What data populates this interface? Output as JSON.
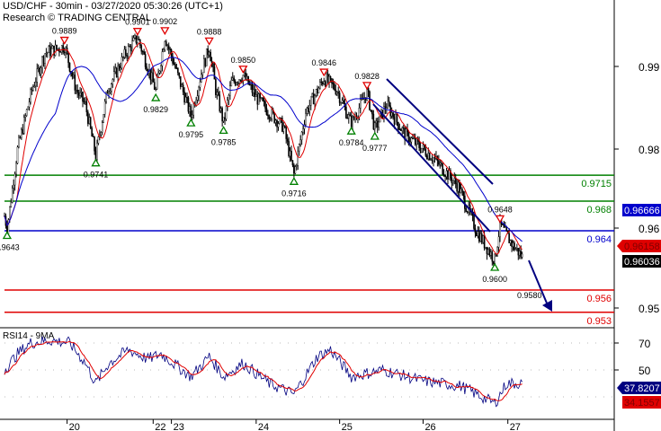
{
  "header": {
    "title": "USD/CHF - 30min - 03/27/2020 05:30:26 (UTC+1)",
    "source": "Research © TRADING CENTRAL"
  },
  "colors": {
    "up_marker": "#008000",
    "down_marker": "#e00000",
    "fast_ma": "#e00000",
    "slow_ma": "#0000cc",
    "channel": "#000080"
  },
  "chart_data": [
    {
      "type": "candlestick",
      "title": "USD/CHF - 30min",
      "x_unit": "30-min bar index",
      "price_axis_ticks": [
        "0.99",
        "0.98",
        "0.96",
        "0.95"
      ],
      "time_ticks": [
        {
          "label": "20",
          "bar": 48
        },
        {
          "label": "22",
          "bar": 114
        },
        {
          "label": "23",
          "bar": 128
        },
        {
          "label": "24",
          "bar": 193
        },
        {
          "label": "25",
          "bar": 257
        },
        {
          "label": "26",
          "bar": 321
        },
        {
          "label": "27",
          "bar": 386
        }
      ],
      "price_path": [
        [
          0,
          0.966
        ],
        [
          2,
          0.9643
        ],
        [
          10,
          0.975
        ],
        [
          21,
          0.983
        ],
        [
          31,
          0.988
        ],
        [
          46,
          0.9889
        ],
        [
          55,
          0.983
        ],
        [
          62,
          0.981
        ],
        [
          70,
          0.9741
        ],
        [
          79,
          0.983
        ],
        [
          93,
          0.988
        ],
        [
          102,
          0.9901
        ],
        [
          110,
          0.986
        ],
        [
          116,
          0.9829
        ],
        [
          123,
          0.9902
        ],
        [
          131,
          0.986
        ],
        [
          143,
          0.9795
        ],
        [
          152,
          0.986
        ],
        [
          157,
          0.9888
        ],
        [
          162,
          0.983
        ],
        [
          168,
          0.9785
        ],
        [
          174,
          0.984
        ],
        [
          183,
          0.985
        ],
        [
          193,
          0.982
        ],
        [
          203,
          0.98
        ],
        [
          214,
          0.978
        ],
        [
          222,
          0.9716
        ],
        [
          231,
          0.98
        ],
        [
          245,
          0.9846
        ],
        [
          255,
          0.983
        ],
        [
          266,
          0.9784
        ],
        [
          278,
          0.9828
        ],
        [
          284,
          0.9777
        ],
        [
          293,
          0.981
        ],
        [
          307,
          0.977
        ],
        [
          328,
          0.974
        ],
        [
          348,
          0.97
        ],
        [
          362,
          0.964
        ],
        [
          369,
          0.962
        ],
        [
          376,
          0.96
        ],
        [
          380,
          0.9648
        ],
        [
          390,
          0.962
        ],
        [
          397,
          0.9605
        ]
      ],
      "markers": [
        {
          "label": "0.9643",
          "type": "low",
          "bar": 2,
          "price": 0.9643
        },
        {
          "label": "0.9889",
          "type": "high",
          "bar": 46,
          "price": 0.9889
        },
        {
          "label": "0.9741",
          "type": "low",
          "bar": 70,
          "price": 0.9741
        },
        {
          "label": "0.9901",
          "type": "high",
          "bar": 102,
          "price": 0.9901
        },
        {
          "label": "0.9829",
          "type": "low",
          "bar": 116,
          "price": 0.9829
        },
        {
          "label": "0.9902",
          "type": "high",
          "bar": 123,
          "price": 0.9902
        },
        {
          "label": "0.9795",
          "type": "low",
          "bar": 143,
          "price": 0.9795
        },
        {
          "label": "0.9888",
          "type": "high",
          "bar": 157,
          "price": 0.9888
        },
        {
          "label": "0.9785",
          "type": "low",
          "bar": 168,
          "price": 0.9785
        },
        {
          "label": "0.9850",
          "type": "high",
          "bar": 183,
          "price": 0.985
        },
        {
          "label": "0.9716",
          "type": "low",
          "bar": 222,
          "price": 0.9716
        },
        {
          "label": "0.9846",
          "type": "high",
          "bar": 245,
          "price": 0.9846
        },
        {
          "label": "0.9784",
          "type": "low",
          "bar": 266,
          "price": 0.9784
        },
        {
          "label": "0.9828",
          "type": "high",
          "bar": 278,
          "price": 0.9828
        },
        {
          "label": "0.9777",
          "type": "low",
          "bar": 284,
          "price": 0.9777
        },
        {
          "label": "0.9600",
          "type": "low",
          "bar": 376,
          "price": 0.96
        },
        {
          "label": "0.9648",
          "type": "high",
          "bar": 380,
          "price": 0.9648
        }
      ],
      "target_label": "0.9580",
      "levels": [
        {
          "label": "0.9715",
          "price": 0.9715,
          "color": "#008000"
        },
        {
          "label": "0.968",
          "price": 0.968,
          "color": "#008000"
        },
        {
          "label": "0.964",
          "price": 0.964,
          "color": "#0000cc"
        },
        {
          "label": "0.956",
          "price": 0.956,
          "color": "#e00000"
        },
        {
          "label": "0.953",
          "price": 0.953,
          "color": "#e00000"
        }
      ],
      "price_tags": [
        {
          "label": "0.96666",
          "bg": "#0000cc"
        },
        {
          "label": "0.96158",
          "bg": "#e00000"
        },
        {
          "label": "0.96036",
          "bg": "#000000"
        }
      ]
    },
    {
      "type": "line",
      "title": "RSI14 - 9MA",
      "y_ticks": [
        "70",
        "50"
      ],
      "rsi_path": [
        [
          0,
          50
        ],
        [
          10,
          62
        ],
        [
          20,
          70
        ],
        [
          35,
          72
        ],
        [
          50,
          70
        ],
        [
          62,
          55
        ],
        [
          70,
          40
        ],
        [
          80,
          55
        ],
        [
          95,
          65
        ],
        [
          110,
          58
        ],
        [
          120,
          62
        ],
        [
          143,
          45
        ],
        [
          157,
          60
        ],
        [
          168,
          45
        ],
        [
          183,
          55
        ],
        [
          203,
          40
        ],
        [
          222,
          32
        ],
        [
          240,
          60
        ],
        [
          250,
          65
        ],
        [
          266,
          45
        ],
        [
          290,
          50
        ],
        [
          320,
          42
        ],
        [
          350,
          38
        ],
        [
          376,
          25
        ],
        [
          385,
          40
        ],
        [
          397,
          40
        ]
      ],
      "tags": [
        {
          "label": "37.8207",
          "bg": "#000080"
        },
        {
          "label": "34.1557",
          "bg": "#e00000"
        }
      ]
    }
  ]
}
